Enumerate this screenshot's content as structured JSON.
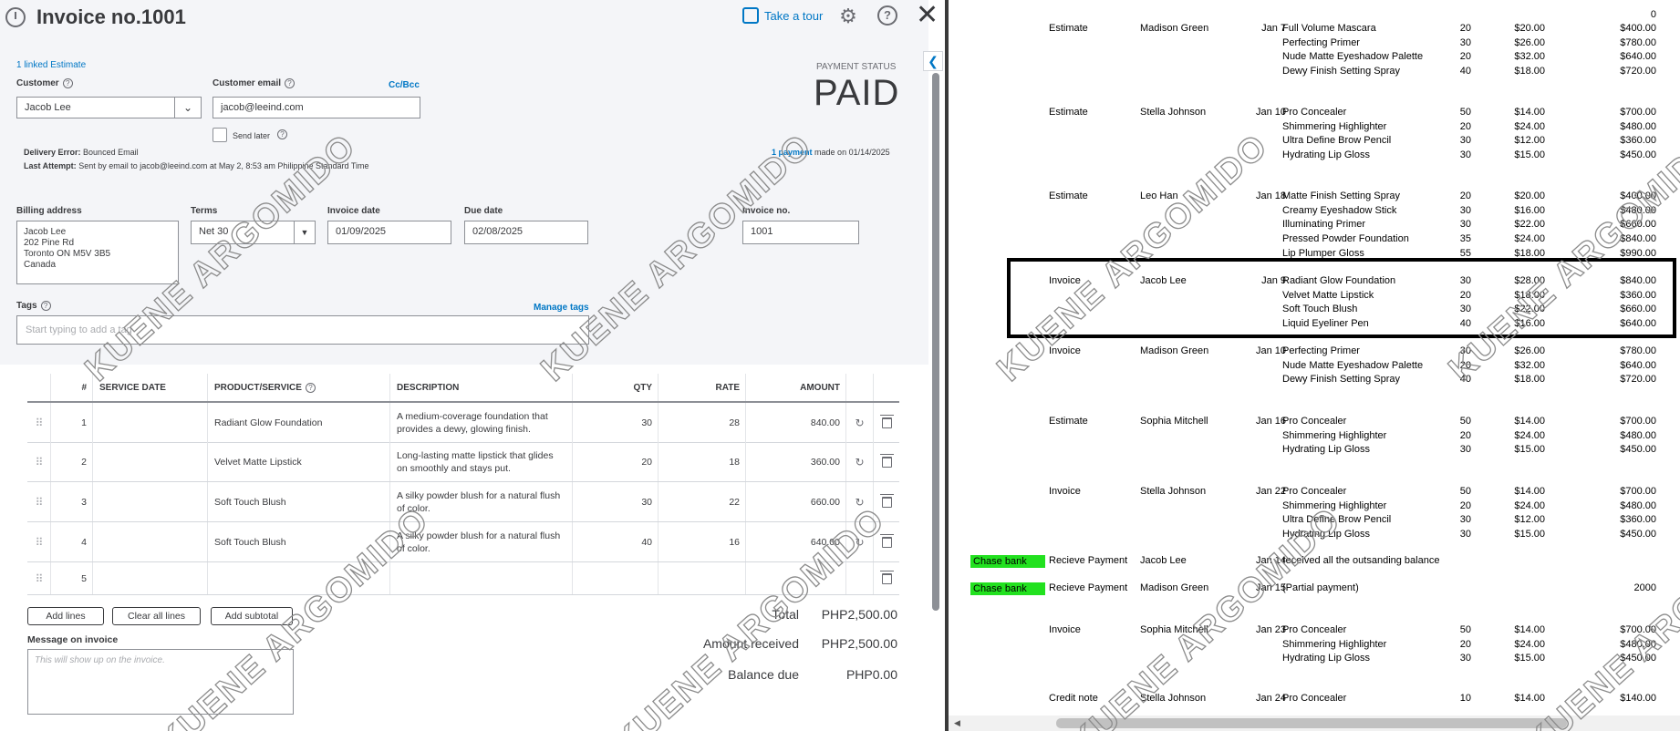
{
  "invoice": {
    "title": "Invoice no.1001",
    "tour_label": "Take a tour",
    "help_label": "?",
    "linked_estimate": "1 linked Estimate",
    "customer_label": "Customer",
    "customer_value": "Jacob Lee",
    "email_label": "Customer email",
    "email_value": "jacob@leeind.com",
    "cc_bcc": "Cc/Bcc",
    "send_later_label": "Send later",
    "delivery_error_label": "Delivery Error:",
    "delivery_error_value": "Bounced Email",
    "last_attempt_label": "Last Attempt:",
    "last_attempt_value": "Sent by email to jacob@leeind.com at May 2, 8:53 am Philippine Standard Time",
    "payment_status_label": "PAYMENT STATUS",
    "payment_status": "PAID",
    "payment_note_link": "1 payment",
    "payment_note_rest": "made on 01/14/2025",
    "billing_label": "Billing address",
    "billing_lines": [
      "Jacob Lee",
      "202 Pine Rd",
      "Toronto ON  M5V 3B5",
      "Canada"
    ],
    "terms_label": "Terms",
    "terms_value": "Net 30",
    "invoice_date_label": "Invoice date",
    "invoice_date": "01/09/2025",
    "due_date_label": "Due date",
    "due_date": "02/08/2025",
    "invoice_no_label": "Invoice no.",
    "invoice_no": "1001",
    "tags_label": "Tags",
    "manage_tags": "Manage tags",
    "tags_placeholder": "Start typing to add a tag"
  },
  "table": {
    "headers": [
      "#",
      "SERVICE DATE",
      "PRODUCT/SERVICE",
      "DESCRIPTION",
      "QTY",
      "RATE",
      "AMOUNT"
    ],
    "rows": [
      {
        "num": "1",
        "product": "Radiant Glow Foundation",
        "desc": "A medium-coverage foundation that provides a dewy, glowing finish.",
        "qty": "30",
        "rate": "28",
        "amount": "840.00"
      },
      {
        "num": "2",
        "product": "Velvet Matte Lipstick",
        "desc": "Long-lasting matte lipstick that glides on smoothly and stays put.",
        "qty": "20",
        "rate": "18",
        "amount": "360.00"
      },
      {
        "num": "3",
        "product": "Soft Touch Blush",
        "desc": "A silky powder blush for a natural flush of color.",
        "qty": "30",
        "rate": "22",
        "amount": "660.00"
      },
      {
        "num": "4",
        "product": "Soft Touch Blush",
        "desc": "A silky powder blush for a natural flush of color.",
        "qty": "40",
        "rate": "16",
        "amount": "640.00"
      },
      {
        "num": "5",
        "product": "",
        "desc": "",
        "qty": "",
        "rate": "",
        "amount": ""
      }
    ]
  },
  "buttons": {
    "add_lines": "Add lines",
    "clear_all": "Clear all lines",
    "add_subtotal": "Add subtotal"
  },
  "totals": {
    "total_label": "Total",
    "total_value": "PHP2,500.00",
    "received_label": "Amount received",
    "received_value": "PHP2,500.00",
    "balance_label": "Balance due",
    "balance_value": "PHP0.00"
  },
  "message": {
    "label": "Message on invoice",
    "placeholder": "This will show up on the invoice."
  },
  "sheet": {
    "top_value": "0",
    "groups": [
      {
        "type": "Estimate",
        "name": "Madison Green",
        "date": "Jan 7",
        "lines": [
          {
            "item": "Full Volume Mascara",
            "qty": "20",
            "rate": "$20.00",
            "amount": "$400.00"
          },
          {
            "item": "Perfecting Primer",
            "qty": "30",
            "rate": "$26.00",
            "amount": "$780.00"
          },
          {
            "item": "Nude Matte Eyeshadow Palette",
            "qty": "20",
            "rate": "$32.00",
            "amount": "$640.00"
          },
          {
            "item": "Dewy Finish Setting Spray",
            "qty": "40",
            "rate": "$18.00",
            "amount": "$720.00"
          }
        ]
      },
      {
        "type": "Estimate",
        "name": "Stella Johnson",
        "date": "Jan 10",
        "lines": [
          {
            "item": "Pro Concealer",
            "qty": "50",
            "rate": "$14.00",
            "amount": "$700.00"
          },
          {
            "item": "Shimmering Highlighter",
            "qty": "20",
            "rate": "$24.00",
            "amount": "$480.00"
          },
          {
            "item": "Ultra Define Brow Pencil",
            "qty": "30",
            "rate": "$12.00",
            "amount": "$360.00"
          },
          {
            "item": "Hydrating Lip Gloss",
            "qty": "30",
            "rate": "$15.00",
            "amount": "$450.00"
          }
        ]
      },
      {
        "type": "Estimate",
        "name": "Leo Han",
        "date": "Jan 18",
        "lines": [
          {
            "item": "Matte Finish Setting Spray",
            "qty": "20",
            "rate": "$20.00",
            "amount": "$400.00"
          },
          {
            "item": "Creamy Eyeshadow Stick",
            "qty": "30",
            "rate": "$16.00",
            "amount": "$480.00"
          },
          {
            "item": "Illuminating Primer",
            "qty": "30",
            "rate": "$22.00",
            "amount": "$660.00"
          },
          {
            "item": "Pressed Powder Foundation",
            "qty": "35",
            "rate": "$24.00",
            "amount": "$840.00"
          },
          {
            "item": "Lip Plumper Gloss",
            "qty": "55",
            "rate": "$18.00",
            "amount": "$990.00"
          }
        ]
      },
      {
        "type": "Invoice",
        "name": "Jacob Lee",
        "date": "Jan 9",
        "lines": [
          {
            "item": "Radiant Glow Foundation",
            "qty": "30",
            "rate": "$28.00",
            "amount": "$840.00"
          },
          {
            "item": "Velvet Matte Lipstick",
            "qty": "20",
            "rate": "$18.00",
            "amount": "$360.00"
          },
          {
            "item": "Soft Touch Blush",
            "qty": "30",
            "rate": "$22.00",
            "amount": "$660.00"
          },
          {
            "item": "Liquid Eyeliner Pen",
            "qty": "40",
            "rate": "$16.00",
            "amount": "$640.00"
          }
        ]
      },
      {
        "type": "Invoice",
        "name": "Madison Green",
        "date": "Jan 10",
        "lines": [
          {
            "item": "Perfecting Primer",
            "qty": "30",
            "rate": "$26.00",
            "amount": "$780.00"
          },
          {
            "item": "Nude Matte Eyeshadow Palette",
            "qty": "20",
            "rate": "$32.00",
            "amount": "$640.00"
          },
          {
            "item": "Dewy Finish Setting Spray",
            "qty": "40",
            "rate": "$18.00",
            "amount": "$720.00"
          }
        ]
      },
      {
        "type": "Estimate",
        "name": "Sophia Mitchell",
        "date": "Jan 16",
        "lines": [
          {
            "item": "Pro Concealer",
            "qty": "50",
            "rate": "$14.00",
            "amount": "$700.00"
          },
          {
            "item": "Shimmering Highlighter",
            "qty": "20",
            "rate": "$24.00",
            "amount": "$480.00"
          },
          {
            "item": "Hydrating Lip Gloss",
            "qty": "30",
            "rate": "$15.00",
            "amount": "$450.00"
          }
        ]
      },
      {
        "type": "Invoice",
        "name": "Stella Johnson",
        "date": "Jan 22",
        "lines": [
          {
            "item": "Pro Concealer",
            "qty": "50",
            "rate": "$14.00",
            "amount": "$700.00"
          },
          {
            "item": "Shimmering Highlighter",
            "qty": "20",
            "rate": "$24.00",
            "amount": "$480.00"
          },
          {
            "item": "Ultra Define Brow Pencil",
            "qty": "30",
            "rate": "$12.00",
            "amount": "$360.00"
          },
          {
            "item": "Hydrating Lip Gloss",
            "qty": "30",
            "rate": "$15.00",
            "amount": "$450.00"
          }
        ]
      },
      {
        "type": "Invoice",
        "name": "Sophia Mitchell",
        "date": "Jan 23",
        "lines": [
          {
            "item": "Pro Concealer",
            "qty": "50",
            "rate": "$14.00",
            "amount": "$700.00"
          },
          {
            "item": "Shimmering Highlighter",
            "qty": "20",
            "rate": "$24.00",
            "amount": "$480.00"
          },
          {
            "item": "Hydrating Lip Gloss",
            "qty": "30",
            "rate": "$15.00",
            "amount": "$450.00"
          }
        ]
      },
      {
        "type": "Credit note",
        "name": "Stella Johnson",
        "date": "Jan 24",
        "lines": [
          {
            "item": "Pro Concealer",
            "qty": "10",
            "rate": "$14.00",
            "amount": "$140.00"
          }
        ]
      }
    ],
    "payments": [
      {
        "bank": "Chase bank",
        "type": "Recieve Payment",
        "name": "Jacob Lee",
        "date": "Jan 14",
        "note": "received all the outsanding balance",
        "amount": ""
      },
      {
        "bank": "Chase bank",
        "type": "Recieve Payment",
        "name": "Madison Green",
        "date": "Jan 15",
        "note": "(Partial payment)",
        "amount": "2000"
      }
    ]
  },
  "watermark": "KUENE ARGOMIDO",
  "colors": {
    "accent": "#0077c5",
    "bank_highlight": "#22e11f",
    "panel_bg": "#f4f5f8"
  }
}
